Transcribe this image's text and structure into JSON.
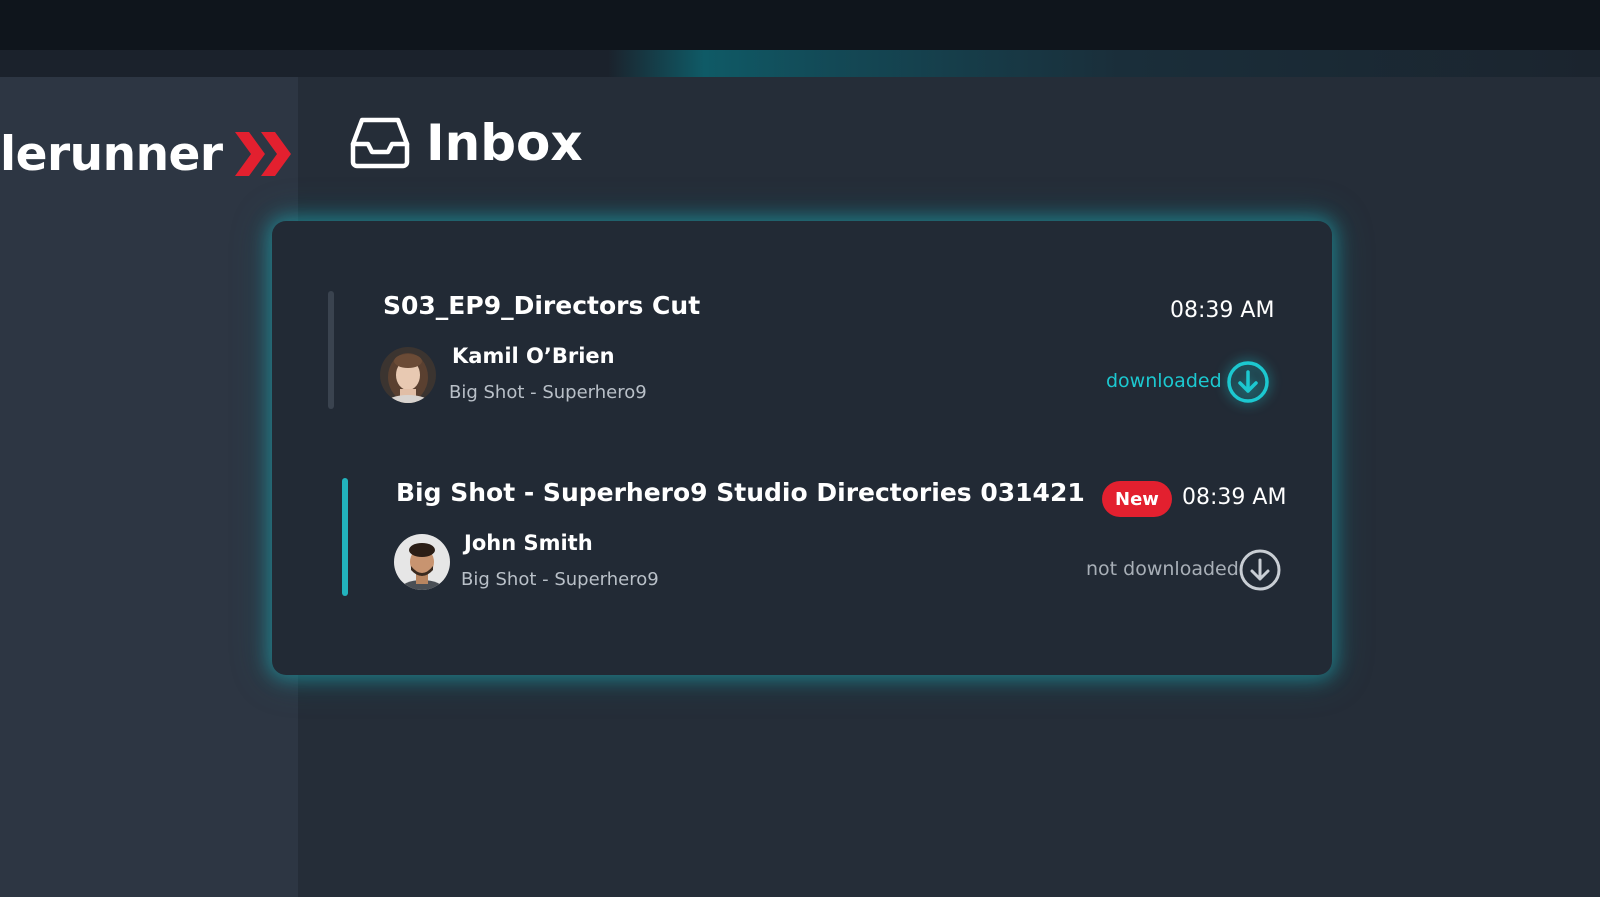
{
  "app": {
    "logo_text": "lerunner",
    "brand_color": "#e3202f",
    "accent_color": "#1cc8d0"
  },
  "header": {
    "title": "Inbox",
    "icon": "inbox-tray-icon"
  },
  "messages": [
    {
      "title": "S03_EP9_Directors Cut",
      "sender": "Kamil O’Brien",
      "project": "Big Shot - Superhero9",
      "time": "08:39 AM",
      "status": "downloaded",
      "status_icon": "download-arrow-icon",
      "is_new": false
    },
    {
      "title": "Big Shot - Superhero9 Studio Directories 031421",
      "sender": "John Smith",
      "project": "Big Shot - Superhero9",
      "time": "08:39 AM",
      "status": "not downloaded",
      "status_icon": "download-arrow-icon",
      "is_new": true,
      "badge": "New"
    }
  ]
}
